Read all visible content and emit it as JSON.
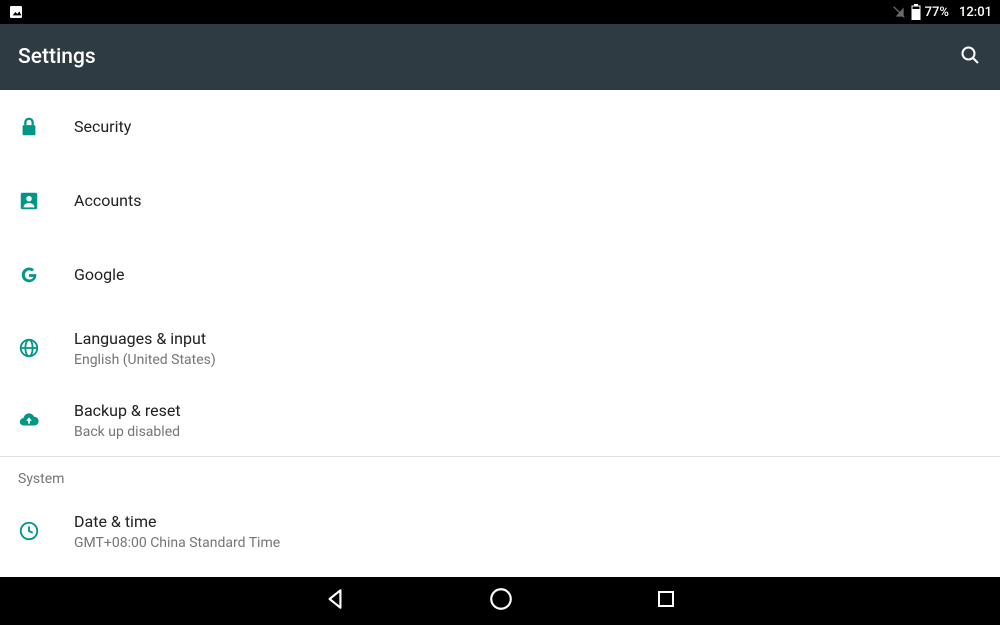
{
  "status_bar": {
    "battery_percent": "77%",
    "clock": "12:01"
  },
  "app_bar": {
    "title": "Settings"
  },
  "items": [
    {
      "icon": "lock",
      "title": "Security",
      "subtitle": null
    },
    {
      "icon": "person",
      "title": "Accounts",
      "subtitle": null
    },
    {
      "icon": "google",
      "title": "Google",
      "subtitle": null
    },
    {
      "icon": "globe",
      "title": "Languages & input",
      "subtitle": "English (United States)"
    },
    {
      "icon": "backup",
      "title": "Backup & reset",
      "subtitle": "Back up disabled"
    }
  ],
  "section_header": "System",
  "system_items": [
    {
      "icon": "clock",
      "title": "Date & time",
      "subtitle": "GMT+08:00 China Standard Time"
    }
  ],
  "colors": {
    "accent": "#009688",
    "appbar": "#2f3b42"
  }
}
